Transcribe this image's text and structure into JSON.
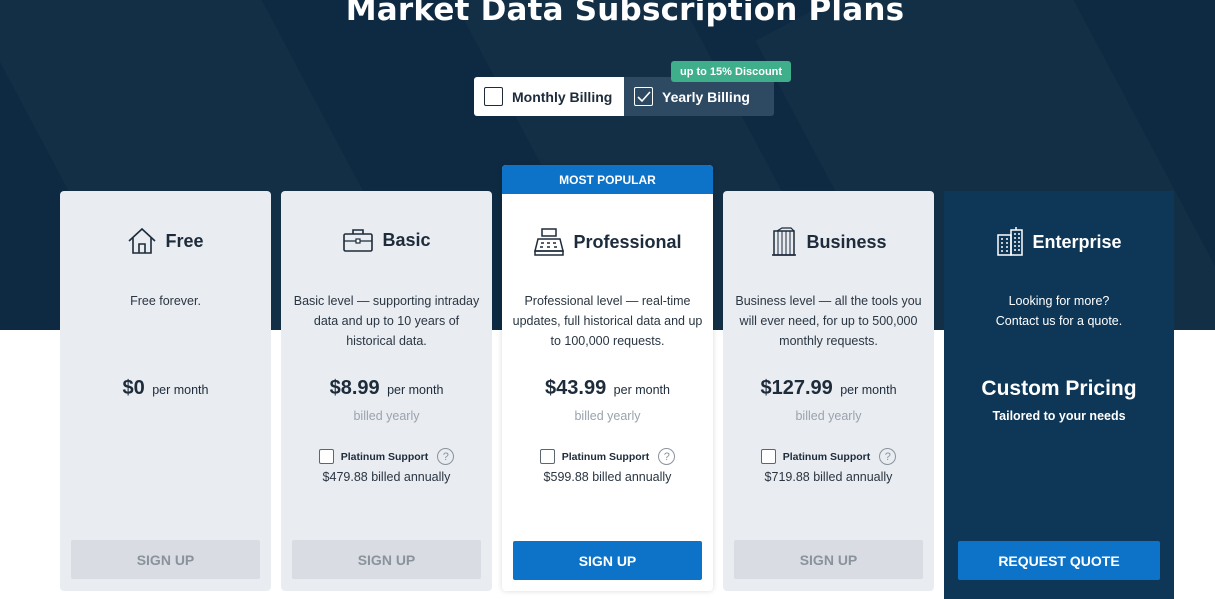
{
  "page": {
    "title": "Market Data Subscription Plans"
  },
  "billing": {
    "monthly_label": "Monthly Billing",
    "yearly_label": "Yearly Billing",
    "selected": "yearly",
    "discount_badge": "up to 15% Discount"
  },
  "plans": [
    {
      "name": "Free",
      "icon": "house-icon",
      "description": "Free forever.",
      "price": "$0",
      "period": "per month",
      "button": "SIGN UP"
    },
    {
      "name": "Basic",
      "icon": "briefcase-icon",
      "description": "Basic level — supporting intraday data and up to 10 years of historical data.",
      "price": "$8.99",
      "period": "per month",
      "billed": "billed yearly",
      "support_label": "Platinum Support",
      "support_help": "?",
      "support_price": "$479.88 billed annually",
      "button": "SIGN UP"
    },
    {
      "name": "Professional",
      "icon": "cash-register-icon",
      "ribbon": "MOST POPULAR",
      "description": "Professional level — real-time updates, full historical data and up to 100,000 requests.",
      "price": "$43.99",
      "period": "per month",
      "billed": "billed yearly",
      "support_label": "Platinum Support",
      "support_help": "?",
      "support_price": "$599.88 billed annually",
      "button": "SIGN UP"
    },
    {
      "name": "Business",
      "icon": "building-icon",
      "description": "Business level — all the tools you will ever need, for up to 500,000 monthly requests.",
      "price": "$127.99",
      "period": "per month",
      "billed": "billed yearly",
      "support_label": "Platinum Support",
      "support_help": "?",
      "support_price": "$719.88 billed annually",
      "button": "SIGN UP"
    },
    {
      "name": "Enterprise",
      "icon": "office-buildings-icon",
      "description": "Looking for more? Contact us for a quote.",
      "price": "Custom Pricing",
      "subtitle": "Tailored to your needs",
      "button": "REQUEST QUOTE"
    }
  ],
  "colors": {
    "hero_bg": "#0e2a42",
    "accent_blue": "#0d73c8",
    "discount_green": "#3fae8a",
    "enterprise_bg": "#0d3657",
    "card_bg": "#e9ecf1"
  }
}
